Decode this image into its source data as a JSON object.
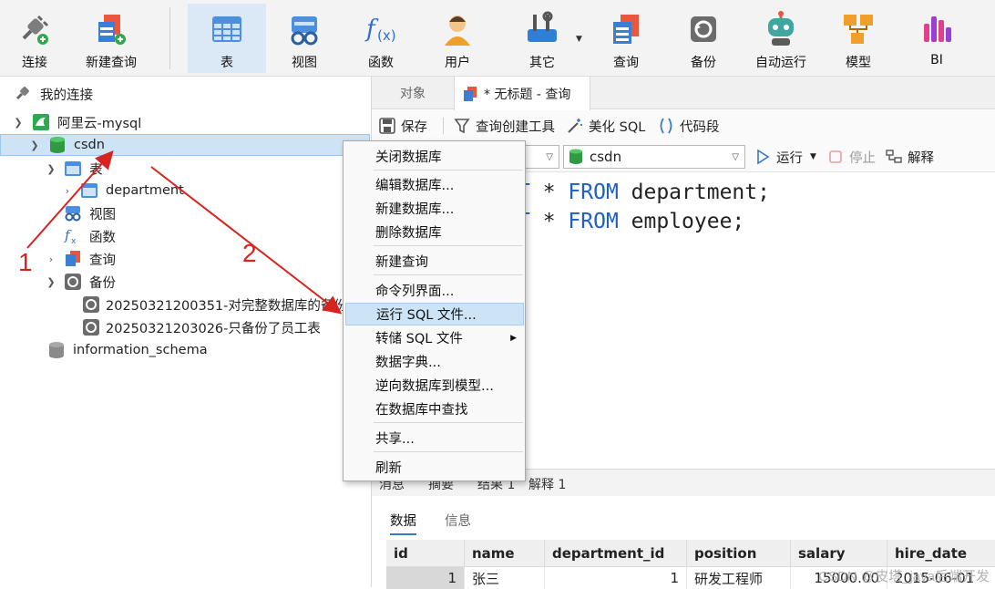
{
  "toolbar": {
    "items": [
      {
        "label": "连接",
        "icon": "plug-connect-icon"
      },
      {
        "label": "新建查询",
        "icon": "new-query-icon"
      },
      {
        "label": "表",
        "icon": "table-icon"
      },
      {
        "label": "视图",
        "icon": "view-icon"
      },
      {
        "label": "函数",
        "icon": "function-icon"
      },
      {
        "label": "用户",
        "icon": "user-icon"
      },
      {
        "label": "其它",
        "icon": "tools-icon"
      },
      {
        "label": "查询",
        "icon": "query-icon"
      },
      {
        "label": "备份",
        "icon": "backup-icon"
      },
      {
        "label": "自动运行",
        "icon": "robot-icon"
      },
      {
        "label": "模型",
        "icon": "model-icon"
      },
      {
        "label": "BI",
        "icon": "bi-chart-icon"
      }
    ]
  },
  "tree": {
    "root": "我的连接",
    "connection": "阿里云-mysql",
    "db_selected": "csdn",
    "tables_label": "表",
    "table_department": "department",
    "views_label": "视图",
    "functions_label": "函数",
    "queries_label": "查询",
    "backups_label": "备份",
    "backup_1": "20250321200351-对完整数据库的备份",
    "backup_2": "20250321203026-只备份了员工表",
    "db_other": "information_schema"
  },
  "tabs": {
    "objects": "对象",
    "query": "* 无标题 - 查询"
  },
  "query_toolbar": {
    "save": "保存",
    "builder": "查询创建工具",
    "beautify": "美化 SQL",
    "snippet": "代码段",
    "db_combo": "csdn",
    "run": "运行",
    "stop": "停止",
    "explain": "解释"
  },
  "editor": {
    "line1_kw1": "T",
    "line1_star": " * ",
    "line1_kw2": "FROM",
    "line1_rest": " department;",
    "line2_kw1": "T",
    "line2_star": " * ",
    "line2_kw2": "FROM",
    "line2_rest": " employee;"
  },
  "result_tabs": {
    "messages": "消息",
    "summary": "摘要",
    "result1": "结果 1",
    "explain1": "解释 1"
  },
  "sub_tabs": {
    "data": "数据",
    "info": "信息"
  },
  "grid": {
    "columns": [
      "id",
      "name",
      "department_id",
      "position",
      "salary",
      "hire_date"
    ],
    "row1": [
      "1",
      "张三",
      "1",
      "研发工程师",
      "15000.00",
      "2015-06-01"
    ]
  },
  "context_menu": {
    "items": [
      "关闭数据库",
      "编辑数据库...",
      "新建数据库...",
      "删除数据库",
      "新建查询",
      "命令列界面...",
      "运行 SQL 文件...",
      "转储 SQL 文件",
      "数据字典...",
      "逆向数据库到模型...",
      "在数据库中查找",
      "共享...",
      "刷新"
    ],
    "highlighted": "运行 SQL 文件..."
  },
  "annotations": {
    "label1": "1",
    "label2": "2",
    "color": "#d8231f"
  },
  "watermark": "CSDN @皮塔_java后端开发"
}
